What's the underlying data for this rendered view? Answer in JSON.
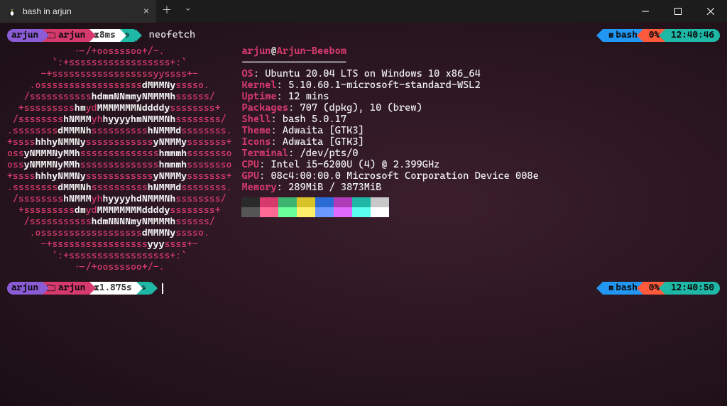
{
  "window": {
    "tab_title": "bash in arjun"
  },
  "prompt1": {
    "user": "arjun",
    "path": "arjun",
    "duration": "8ms",
    "branch_icon": "✲",
    "command": "neofetch"
  },
  "status1": {
    "shell": "bash",
    "cpu": "0%",
    "clock": "12:40:46"
  },
  "prompt2": {
    "user": "arjun",
    "path": "arjun",
    "duration": "1.875s",
    "branch_icon": "✲"
  },
  "status2": {
    "shell": "bash",
    "cpu": "0%",
    "clock": "12:40:50"
  },
  "neofetch": {
    "user": "arjun",
    "host": "Arjun-Beebom",
    "dashes": "------------------",
    "rows": [
      {
        "key": "OS",
        "val": "Ubuntu 20.04 LTS on Windows 10 x86_64"
      },
      {
        "key": "Kernel",
        "val": "5.10.60.1-microsoft-standard-WSL2"
      },
      {
        "key": "Uptime",
        "val": "12 mins"
      },
      {
        "key": "Packages",
        "val": "707 (dpkg), 10 (brew)"
      },
      {
        "key": "Shell",
        "val": "bash 5.0.17"
      },
      {
        "key": "Theme",
        "val": "Adwaita [GTK3]"
      },
      {
        "key": "Icons",
        "val": "Adwaita [GTK3]"
      },
      {
        "key": "Terminal",
        "val": "/dev/pts/0"
      },
      {
        "key": "CPU",
        "val": "Intel i5-6200U (4) @ 2.399GHz"
      },
      {
        "key": "GPU",
        "val": "08c4:00:00.0 Microsoft Corporation Device 008e"
      },
      {
        "key": "Memory",
        "val": "289MiB / 3873MiB"
      }
    ],
    "colors_row1": [
      "#2a2a2a",
      "#d63a6d",
      "#3cb371",
      "#d8c22a",
      "#2a6bd6",
      "#b03ab8",
      "#1fb7a5",
      "#c8c8c8"
    ],
    "colors_row2": [
      "#555555",
      "#ff6a95",
      "#6aff9a",
      "#fff06a",
      "#6a9aff",
      "#e06aff",
      "#5affee",
      "#ffffff"
    ]
  },
  "ascii": [
    [
      [
        "r",
        "            .-/+oossssoo+/-."
      ]
    ],
    [
      [
        "r",
        "        `:+ssssssssssssssssss+:`"
      ]
    ],
    [
      [
        "r",
        "      -+ssssssssssssssssssyyssss+-"
      ]
    ],
    [
      [
        "r",
        "    .ossssssssssssssssss"
      ],
      [
        "w",
        "dMMMNy"
      ],
      [
        "r",
        "sssso."
      ]
    ],
    [
      [
        "r",
        "   /sssssssssss"
      ],
      [
        "w",
        "hdmmNNmmyNMMMMh"
      ],
      [
        "r",
        "ssssss/"
      ]
    ],
    [
      [
        "r",
        "  +sssssssss"
      ],
      [
        "w",
        "hm"
      ],
      [
        "r",
        "yd"
      ],
      [
        "w",
        "MMMMMMMNddddy"
      ],
      [
        "r",
        "ssssssss+"
      ]
    ],
    [
      [
        "r",
        " /ssssssss"
      ],
      [
        "w",
        "hNMMM"
      ],
      [
        "r",
        "yh"
      ],
      [
        "w",
        "hyyyyhmNMMMNh"
      ],
      [
        "r",
        "ssssssss/"
      ]
    ],
    [
      [
        "r",
        ".ssssssss"
      ],
      [
        "w",
        "dMMMNh"
      ],
      [
        "r",
        "ssssssssss"
      ],
      [
        "w",
        "hNMMMd"
      ],
      [
        "r",
        "ssssssss."
      ]
    ],
    [
      [
        "r",
        "+ssss"
      ],
      [
        "w",
        "hhhyNMMNy"
      ],
      [
        "r",
        "ssssssssssss"
      ],
      [
        "w",
        "yNMMMy"
      ],
      [
        "r",
        "sssssss+"
      ]
    ],
    [
      [
        "r",
        "oss"
      ],
      [
        "w",
        "yNMMMNyMMh"
      ],
      [
        "r",
        "ssssssssssssss"
      ],
      [
        "w",
        "hmmmh"
      ],
      [
        "r",
        "ssssssso"
      ]
    ],
    [
      [
        "r",
        "oss"
      ],
      [
        "w",
        "yNMMMNyMMh"
      ],
      [
        "r",
        "ssssssssssssss"
      ],
      [
        "w",
        "hmmmh"
      ],
      [
        "r",
        "ssssssso"
      ]
    ],
    [
      [
        "r",
        "+ssss"
      ],
      [
        "w",
        "hhhyNMMNy"
      ],
      [
        "r",
        "ssssssssssss"
      ],
      [
        "w",
        "yNMMMy"
      ],
      [
        "r",
        "sssssss+"
      ]
    ],
    [
      [
        "r",
        ".ssssssss"
      ],
      [
        "w",
        "dMMMNh"
      ],
      [
        "r",
        "ssssssssss"
      ],
      [
        "w",
        "hNMMMd"
      ],
      [
        "r",
        "ssssssss."
      ]
    ],
    [
      [
        "r",
        " /ssssssss"
      ],
      [
        "w",
        "hNMMM"
      ],
      [
        "r",
        "yh"
      ],
      [
        "w",
        "hyyyyhdNMMMNh"
      ],
      [
        "r",
        "ssssssss/"
      ]
    ],
    [
      [
        "r",
        "  +sssssssss"
      ],
      [
        "w",
        "dm"
      ],
      [
        "r",
        "yd"
      ],
      [
        "w",
        "MMMMMMMMddddy"
      ],
      [
        "r",
        "ssssssss+"
      ]
    ],
    [
      [
        "r",
        "   /sssssssssss"
      ],
      [
        "w",
        "hdmNNNNmyNMMMMh"
      ],
      [
        "r",
        "ssssss/"
      ]
    ],
    [
      [
        "r",
        "    .ossssssssssssssssss"
      ],
      [
        "w",
        "dMMMNy"
      ],
      [
        "r",
        "sssso."
      ]
    ],
    [
      [
        "r",
        "      -+sssssssssssssssss"
      ],
      [
        "w",
        "yyy"
      ],
      [
        "r",
        "ssss+-"
      ]
    ],
    [
      [
        "r",
        "        `:+ssssssssssssssssss+:`"
      ]
    ],
    [
      [
        "r",
        "            .-/+oossssoo+/-."
      ]
    ]
  ]
}
